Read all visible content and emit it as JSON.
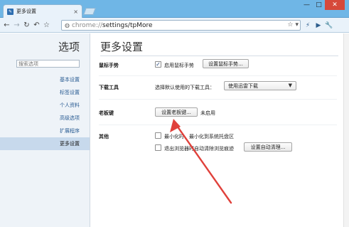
{
  "window": {
    "tab_title": "更多设置",
    "tab_favicon": "✎",
    "tab_close": "×",
    "minimize": "—",
    "maximize": "□",
    "close": "✕"
  },
  "toolbar": {
    "back": "←",
    "forward": "→",
    "reload": "↻",
    "undo": "↶",
    "star": "☆",
    "page_icon": "◍",
    "url_scheme": "chrome://",
    "url_path": "settings/tpMore",
    "bookmark_star": "☆",
    "dropdown": "▾",
    "ext1": "⚡",
    "ext2": "▶",
    "wrench": "🔧"
  },
  "sidebar": {
    "title": "选项",
    "search_placeholder": "搜索选项",
    "items": [
      {
        "label": "基本设置"
      },
      {
        "label": "标签设置"
      },
      {
        "label": "个人资料"
      },
      {
        "label": "高级选项"
      },
      {
        "label": "扩展程序"
      },
      {
        "label": "更多设置"
      }
    ]
  },
  "main": {
    "title": "更多设置",
    "mouse_gesture": {
      "label": "鼠标手势",
      "checkbox_label": "启用鼠标手势",
      "checked": true,
      "button": "设置鼠标手势..."
    },
    "download": {
      "label": "下载工具",
      "prompt": "选择默认使用的下载工具：",
      "selected": "使用迅雷下载",
      "arrow": "▼"
    },
    "boss_key": {
      "label": "老板键",
      "button": "设置老板键...",
      "status": "未启用"
    },
    "other": {
      "label": "其他",
      "option1": "最小化时，最小化到系统托盘区",
      "option2": "退出浏览器时自动清除浏览痕迹",
      "button": "设置自动清理..."
    }
  },
  "colors": {
    "annotation_arrow": "#e0413b"
  }
}
